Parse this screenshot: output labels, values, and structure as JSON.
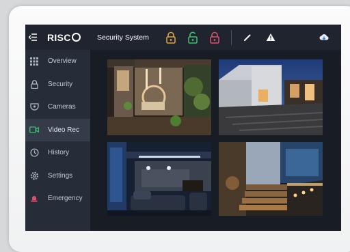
{
  "app": {
    "brand": "RISCO",
    "title": "Security System"
  },
  "sidebar": {
    "items": [
      {
        "label": "Overview",
        "icon": "grid-icon"
      },
      {
        "label": "Security",
        "icon": "lock-icon"
      },
      {
        "label": "Cameras",
        "icon": "camera-icon"
      },
      {
        "label": "Video Rec",
        "icon": "video-icon",
        "active": true
      },
      {
        "label": "History",
        "icon": "history-icon"
      },
      {
        "label": "Settings",
        "icon": "settings-icon"
      },
      {
        "label": "Emergency",
        "icon": "emergency-icon"
      }
    ]
  },
  "topbar": {
    "locks": [
      {
        "name": "partial-arm",
        "color": "#e2a83a"
      },
      {
        "name": "disarmed",
        "color": "#3ec46d"
      },
      {
        "name": "armed",
        "color": "#e0506a"
      }
    ]
  },
  "colors": {
    "accent_green": "#3ec46d",
    "alert_red": "#e0506a",
    "amber": "#e2a83a"
  }
}
